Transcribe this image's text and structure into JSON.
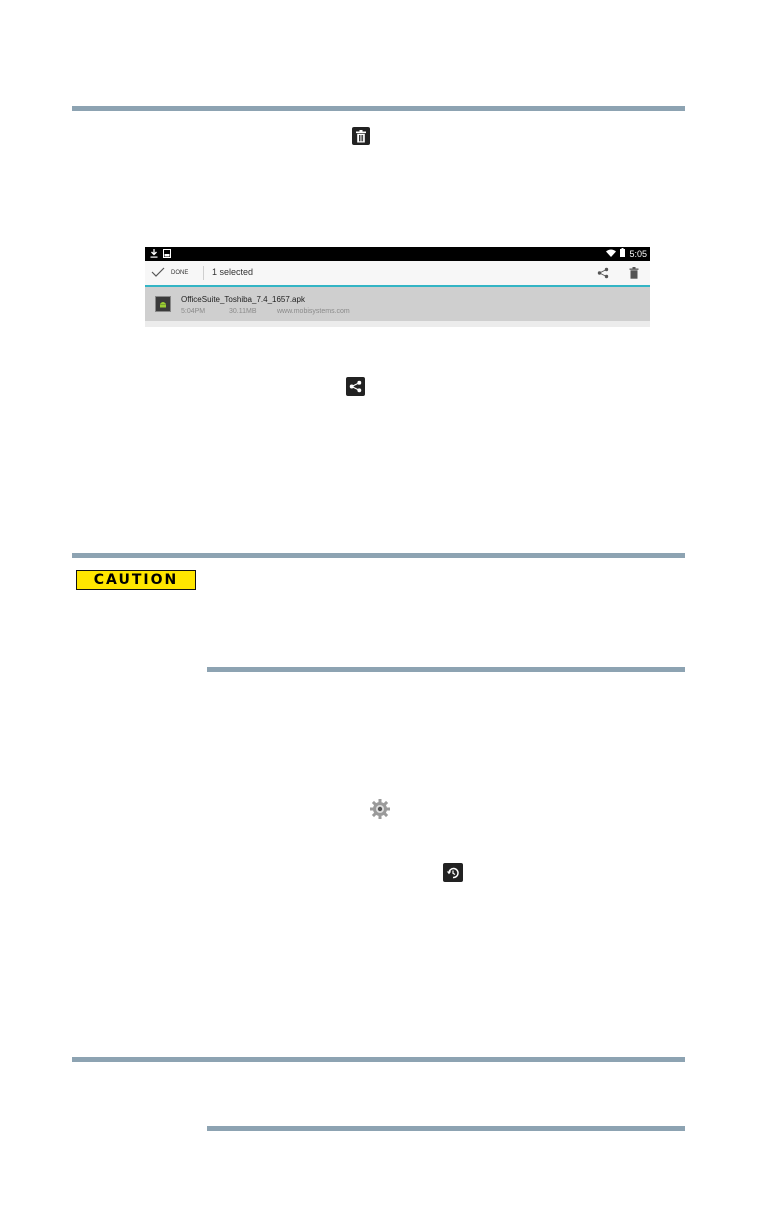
{
  "screenshot": {
    "status_bar": {
      "time": "5:05"
    },
    "action_bar": {
      "done_label": "DONE",
      "selected_count": "1 selected"
    },
    "file_row": {
      "name": "OfficeSuite_Toshiba_7.4_1657.apk",
      "time": "5:04PM",
      "size": "30.11MB",
      "source": "www.mobisystems.com"
    }
  },
  "caution_badge": {
    "label": "CAUTION",
    "color": "#ffe600"
  },
  "icons": {
    "inline_1": "trash-icon",
    "inline_2": "share-icon",
    "inline_3": "settings-gear-icon",
    "inline_4": "restore-icon"
  },
  "colors": {
    "rule": "#8da3b2",
    "accent": "#33b5c5"
  }
}
